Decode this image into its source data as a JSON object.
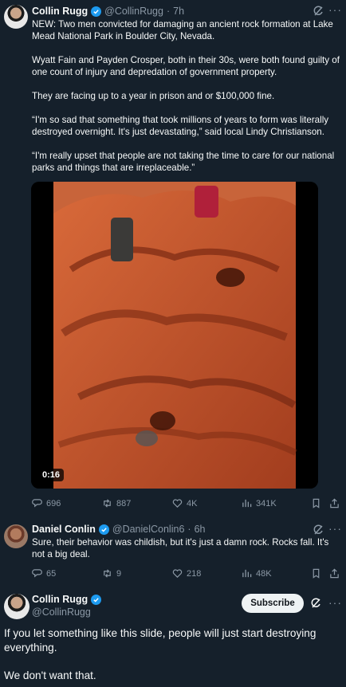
{
  "tweet1": {
    "name": "Collin Rugg",
    "handle": "@CollinRugg",
    "sep": "·",
    "time": "7h",
    "paragraphs": [
      "NEW: Two men convicted for damaging an ancient rock formation at Lake Mead National Park in Boulder City, Nevada.",
      "Wyatt Fain and Payden Crosper, both in their 30s, were both found guilty of one count of injury and depredation of government property.",
      "They are facing up to a year in prison and or $100,000 fine.",
      "“I'm so sad that something that took millions of years to form was literally destroyed overnight. It's just devastating,” said local Lindy Christianson.",
      "“I'm really upset that people are not taking the time to care for our national parks and things that are irreplaceable.”"
    ],
    "video_duration": "0:16",
    "stats": {
      "replies": "696",
      "retweets": "887",
      "likes": "4K",
      "views": "341K"
    }
  },
  "reply": {
    "name": "Daniel Conlin",
    "handle": "@DanielConlin6",
    "sep": "·",
    "time": "6h",
    "text": "Sure, their behavior was childish, but it's just a damn rock. Rocks fall. It's not a big deal.",
    "stats": {
      "replies": "65",
      "retweets": "9",
      "likes": "218",
      "views": "48K"
    }
  },
  "tweet2": {
    "name": "Collin Rugg",
    "handle": "@CollinRugg",
    "subscribe_label": "Subscribe",
    "paragraphs": [
      "If you let something like this slide, people will just start destroying everything.",
      "We don't want that."
    ]
  },
  "colors": {
    "background": "#15202b",
    "accent": "#1d9bf0",
    "muted": "#8b98a5"
  }
}
